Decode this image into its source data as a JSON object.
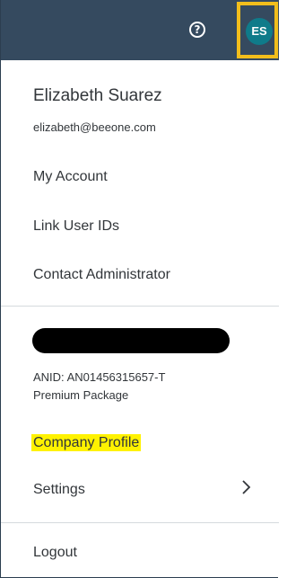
{
  "header": {
    "help_icon_glyph": "?",
    "avatar_initials": "ES",
    "avatar_color": "#0f7b8a",
    "highlight_color": "#f2be1c"
  },
  "user": {
    "name": "Elizabeth Suarez",
    "email": "elizabeth@beeone.com"
  },
  "menu": {
    "my_account": "My Account",
    "link_user_ids": "Link User IDs",
    "contact_admin": "Contact Administrator"
  },
  "company": {
    "anid": "ANID: AN01456315657-T",
    "package": "Premium Package",
    "company_profile": "Company Profile",
    "settings": "Settings",
    "text_highlight_color": "#fff200"
  },
  "footer": {
    "logout": "Logout"
  }
}
